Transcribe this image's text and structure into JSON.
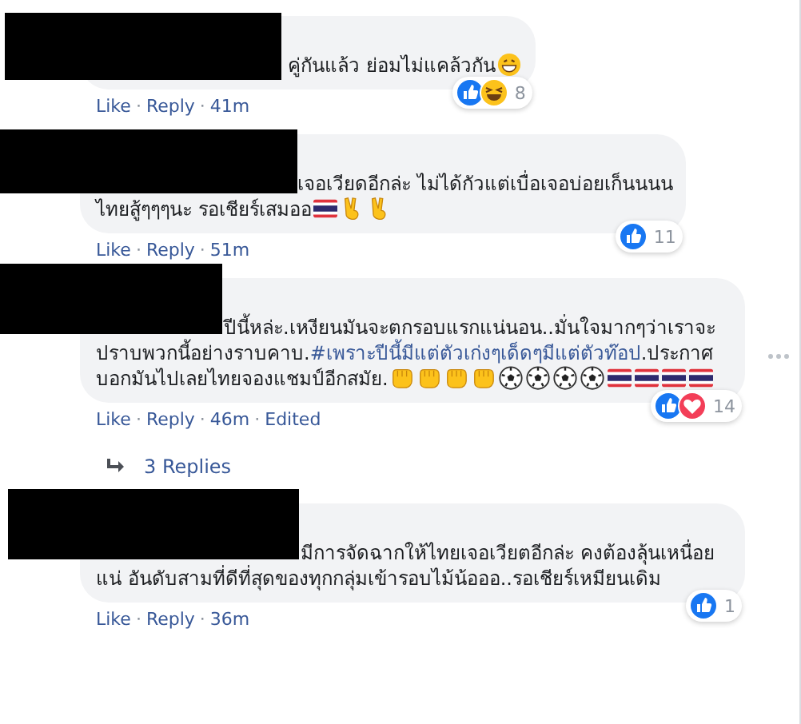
{
  "comments": [
    {
      "redacted": true,
      "body": [
        {
          "kind": "text",
          "text": "คู่กันแล้ว ย่อมไม่แคล้วกัน"
        },
        {
          "kind": "grin"
        }
      ],
      "actions": [
        {
          "kind": "link",
          "text": "Like"
        },
        {
          "kind": "dot",
          "text": "·"
        },
        {
          "kind": "link",
          "text": "Reply"
        },
        {
          "kind": "dot",
          "text": "·"
        },
        {
          "kind": "time",
          "text": "41m"
        }
      ],
      "reactions": [
        {
          "kind": "like"
        },
        {
          "kind": "haha"
        }
      ],
      "reaction_count": "8",
      "more_button": false
    },
    {
      "redacted": true,
      "body": [
        {
          "kind": "text",
          "text": "เจอเวียดอีกล่ะ ไม่ได้กัวแต่เบื่อเจอบ่อยเก็นนนน\nไทยสู้ๆๆๆนะ รอเชียร์เสมออ"
        },
        {
          "kind": "flag"
        },
        {
          "kind": "victory"
        },
        {
          "kind": "victory"
        }
      ],
      "actions": [
        {
          "kind": "link",
          "text": "Like"
        },
        {
          "kind": "dot",
          "text": "·"
        },
        {
          "kind": "link",
          "text": "Reply"
        },
        {
          "kind": "dot",
          "text": "·"
        },
        {
          "kind": "time",
          "text": "51m"
        }
      ],
      "reactions": [
        {
          "kind": "like"
        }
      ],
      "reaction_count": "11",
      "more_button": false
    },
    {
      "redacted": true,
      "body": [
        {
          "kind": "text",
          "text": "ปีนี้หล่ะ.เหงียนมันจะตกรอบแรกแน่นอน..มั่นใจมากๆว่าเราจะปราบพวกนี้อย่างราบคาบ."
        },
        {
          "kind": "hashtag",
          "text": "#เพราะปีนี้มีแต่ตัวเก่งๆเด็ดๆมีแต่ตัวท๊อป"
        },
        {
          "kind": "text",
          "text": ".ประกาศบอกมันไปเลยไทยจองแชมป์อีกสมัย."
        },
        {
          "kind": "fist"
        },
        {
          "kind": "fist"
        },
        {
          "kind": "fist"
        },
        {
          "kind": "fist"
        },
        {
          "kind": "ball"
        },
        {
          "kind": "ball"
        },
        {
          "kind": "ball"
        },
        {
          "kind": "ball"
        },
        {
          "kind": "flag"
        },
        {
          "kind": "flag"
        },
        {
          "kind": "flag"
        },
        {
          "kind": "flag"
        }
      ],
      "actions": [
        {
          "kind": "link",
          "text": "Like"
        },
        {
          "kind": "dot",
          "text": "·"
        },
        {
          "kind": "link",
          "text": "Reply"
        },
        {
          "kind": "dot",
          "text": "·"
        },
        {
          "kind": "time",
          "text": "46m"
        },
        {
          "kind": "dot",
          "text": "·"
        },
        {
          "kind": "time",
          "text": "Edited"
        }
      ],
      "reactions": [
        {
          "kind": "like"
        },
        {
          "kind": "love"
        }
      ],
      "reaction_count": "14",
      "more_button": true,
      "replies": "3 Replies"
    },
    {
      "redacted": true,
      "body": [
        {
          "kind": "text",
          "text": "มีการจัดฉากให้ไทยเจอเวียตอีกล่ะ คงต้องลุ้นเหนื่อยแน่ อันดับสามที่ดีที่สุดของทุกกลุ่มเข้ารอบไม้น้อออ..รอเชียร์เหมียนเดิม"
        }
      ],
      "actions": [
        {
          "kind": "link",
          "text": "Like"
        },
        {
          "kind": "dot",
          "text": "·"
        },
        {
          "kind": "link",
          "text": "Reply"
        },
        {
          "kind": "dot",
          "text": "·"
        },
        {
          "kind": "time",
          "text": "36m"
        }
      ],
      "reactions": [
        {
          "kind": "like"
        }
      ],
      "reaction_count": "1",
      "more_button": false
    }
  ]
}
